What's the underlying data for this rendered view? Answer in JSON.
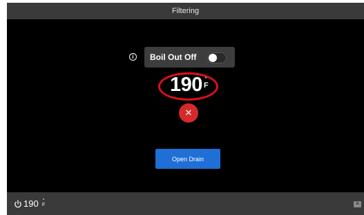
{
  "header": {
    "title": "Filtering"
  },
  "boil_out": {
    "label": "Boil Out Off",
    "toggle_state": "off",
    "info_glyph": "i"
  },
  "temperature": {
    "value": "190",
    "unit_top": "°",
    "unit_bottom": "F",
    "highlight_color": "#e0101a"
  },
  "cancel": {
    "glyph": "✕",
    "color": "#d52a2a"
  },
  "drain": {
    "label": "Open Drain",
    "color": "#1f6fd6"
  },
  "statusbar": {
    "power_icon": "power-icon",
    "temperature": "190",
    "unit_top": "°",
    "unit_bottom": "F",
    "language_icon": "language-icon"
  }
}
